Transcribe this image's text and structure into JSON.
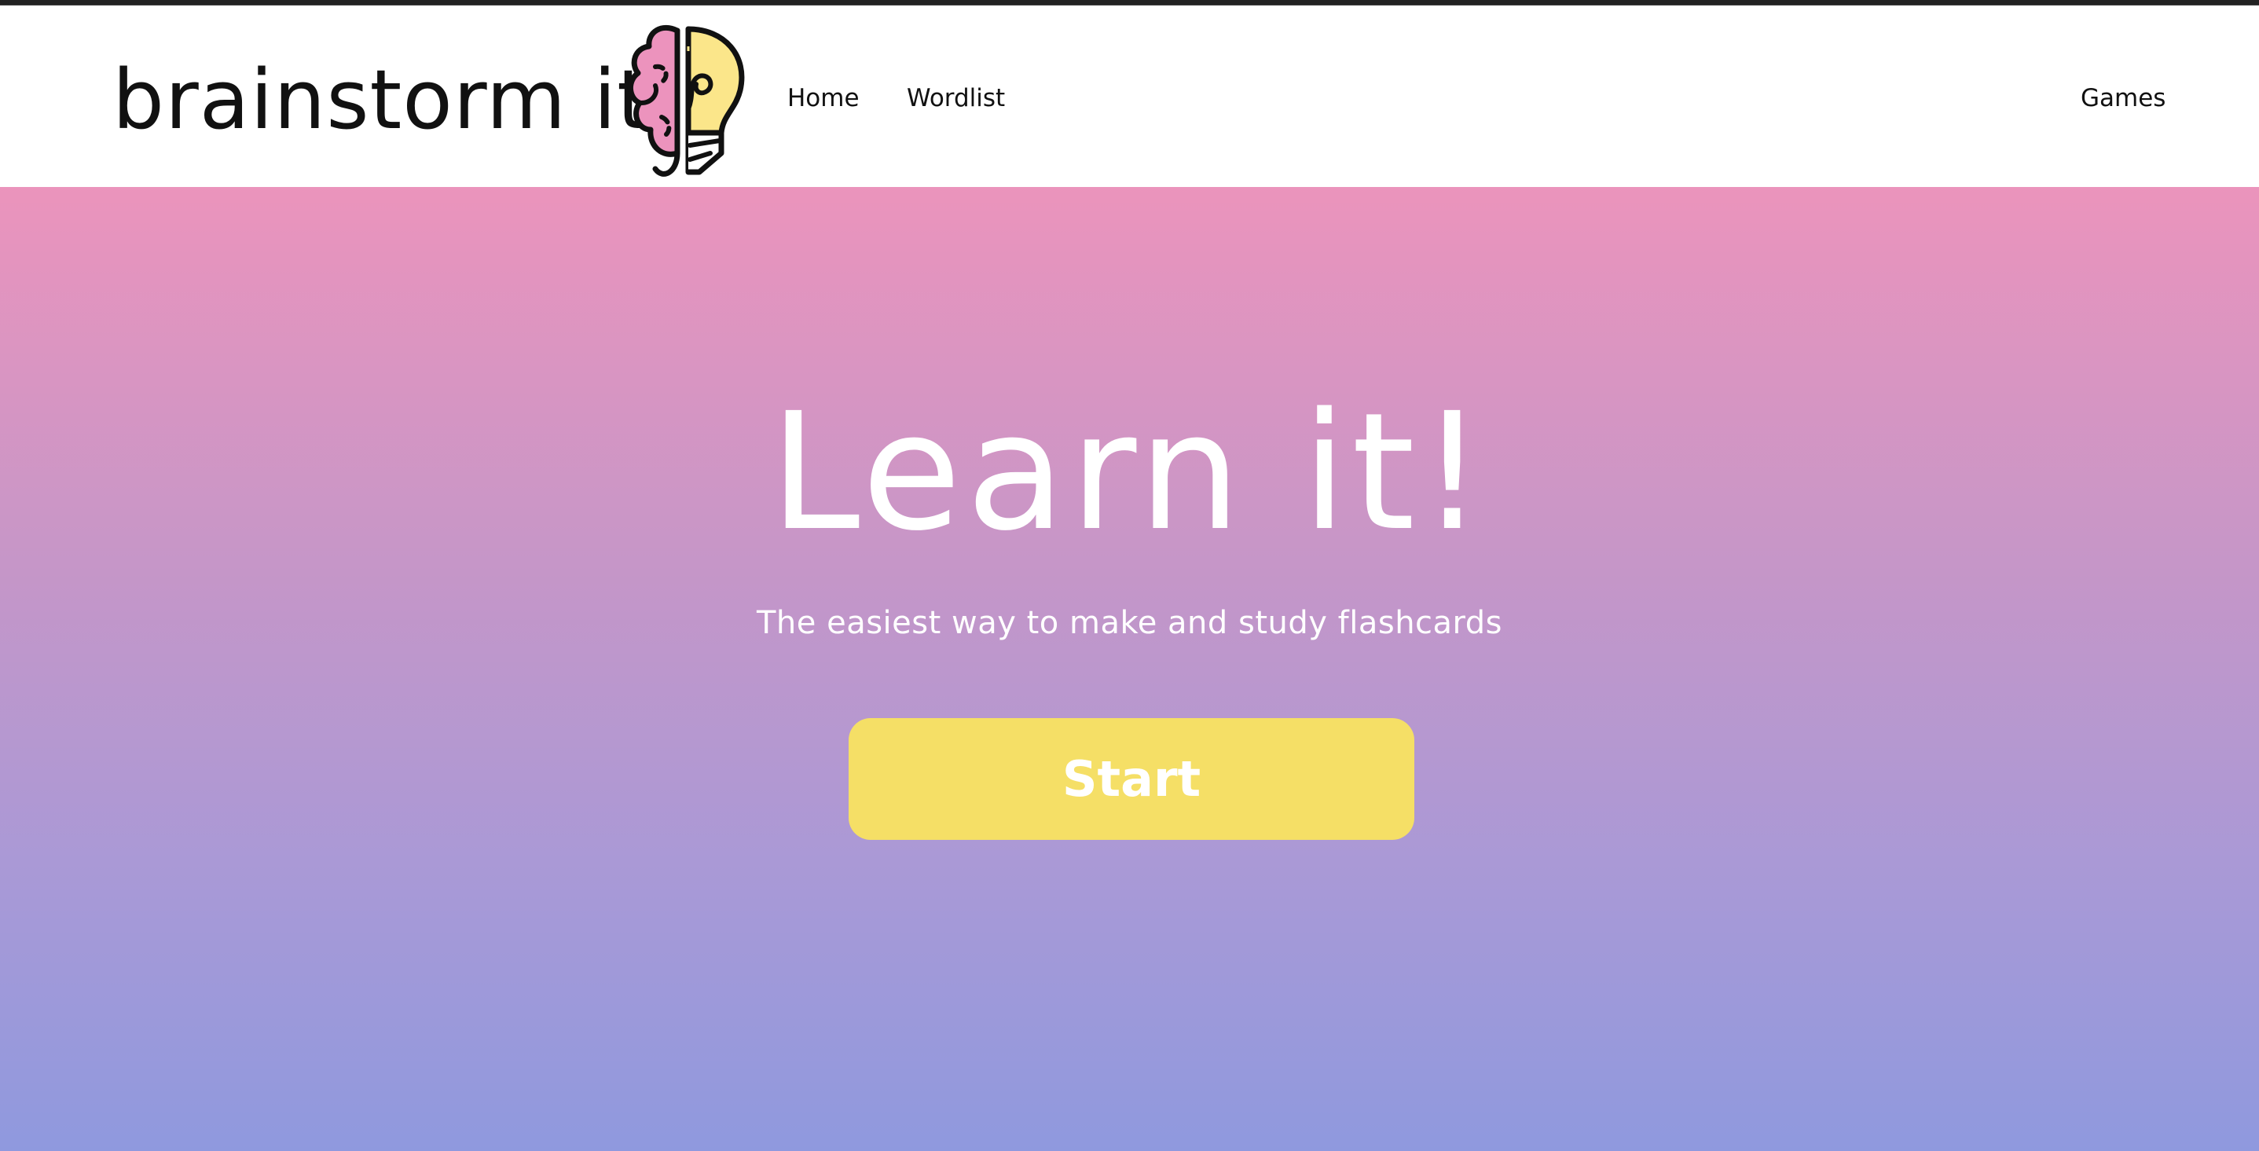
{
  "brand": {
    "name": "brainstorm it!",
    "logo_icon": "brain-lightbulb-icon"
  },
  "nav": {
    "home_label": "Home",
    "wordlist_label": "Wordlist",
    "games_label": "Games"
  },
  "hero": {
    "title": "Learn it!",
    "subtitle": "The easiest way to make and study flashcards",
    "start_label": "Start"
  },
  "colors": {
    "gradient_top": "#eb94bc",
    "gradient_bottom": "#8f99de",
    "button": "#f5df66",
    "logo_brain": "#ec93bd",
    "logo_bulb": "#fbe68a"
  }
}
